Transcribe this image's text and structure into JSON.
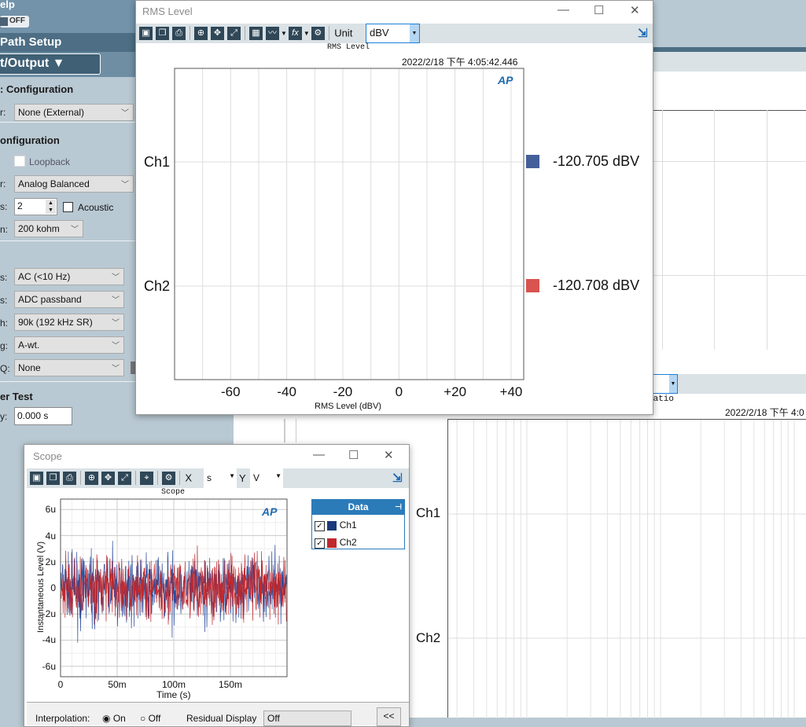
{
  "left_panel": {
    "menu_help": "elp",
    "toggle": "OFF",
    "path_setup": "Path Setup",
    "io_selector": "t/Output ▼",
    "output_config": ": Configuration",
    "output_label": "r:",
    "output_value": "None (External)",
    "input_config": "onfiguration",
    "loopback": "Loopback",
    "connector_label": "r:",
    "connector_value": "Analog Balanced",
    "channels_label": "s:",
    "channels_value": "2",
    "acoustic": "Acoustic",
    "impedance_label": "n:",
    "impedance_value": "200 kohm",
    "coupling_label": "s:",
    "coupling_value": "AC (<10 Hz)",
    "filters_label": "s:",
    "filters_value": "ADC passband",
    "bandwidth_label": "h:",
    "bandwidth_value": "90k (192 kHz SR)",
    "weighting_label": "g:",
    "weighting_value": "A-wt.",
    "eq_label": "Q:",
    "eq_value": "None",
    "test_section": "er Test",
    "delay_label": "y:",
    "delay_value": "0.000 s"
  },
  "rms_window": {
    "title": "RMS Level",
    "unit_label": "Unit",
    "unit_value": "dBV",
    "graph_title": "RMS Level",
    "timestamp": "2022/2/18 下午 4:05:42.446",
    "xlabel": "RMS Level (dBV)",
    "logo": "AP",
    "categories": [
      "Ch1",
      "Ch2"
    ],
    "readouts": [
      "-120.705 dBV",
      "-120.708 dBV"
    ],
    "colors": [
      "#44609a",
      "#d9534f"
    ],
    "xticks": [
      "-60",
      "-40",
      "-20",
      "0",
      "+20",
      "+40"
    ]
  },
  "bg_window": {
    "graph_title_fragment": "Ratio",
    "timestamp": "2022/2/18 下午 4:0",
    "rows": [
      "Ch1",
      "Ch2"
    ]
  },
  "scope_window": {
    "title": "Scope",
    "graph_title": "Scope",
    "x_label": "X",
    "x_unit": "s",
    "y_label": "Y",
    "y_unit": "V",
    "legend_title": "Data",
    "legend": [
      {
        "name": "Ch1",
        "color": "#1a3a7a",
        "checked": true
      },
      {
        "name": "Ch2",
        "color": "#c0282d",
        "checked": true
      }
    ],
    "bottom": {
      "interpolation": "Interpolation:",
      "on": "On",
      "off": "Off",
      "residual": "Residual Display",
      "residual_value": "Off",
      "collapse": "<<"
    }
  },
  "chart_data": [
    {
      "type": "bar",
      "title": "RMS Level",
      "xlabel": "RMS Level (dBV)",
      "categories": [
        "Ch1",
        "Ch2"
      ],
      "values": [
        -120.705,
        -120.708
      ],
      "xlim": [
        -80,
        44.5
      ],
      "xticks": [
        -60,
        -40,
        -20,
        0,
        20,
        40
      ],
      "grid": true
    },
    {
      "type": "line",
      "title": "Scope",
      "xlabel": "Time (s)",
      "ylabel": "Instantaneous Level (V)",
      "xlim": [
        0,
        0.2
      ],
      "ylim": [
        -6.8e-06,
        6.8e-06
      ],
      "xticks": [
        "0",
        "50m",
        "100m",
        "150m"
      ],
      "yticks": [
        "6u",
        "4u",
        "2u",
        "0",
        "-2u",
        "-4u",
        "-6u"
      ],
      "grid": true,
      "series": [
        {
          "name": "Ch1",
          "color": "#2b4a9a",
          "envelope": [
            -4e-06,
            4e-06
          ]
        },
        {
          "name": "Ch2",
          "color": "#c0282d",
          "envelope": [
            -4e-06,
            4e-06
          ]
        }
      ]
    }
  ]
}
